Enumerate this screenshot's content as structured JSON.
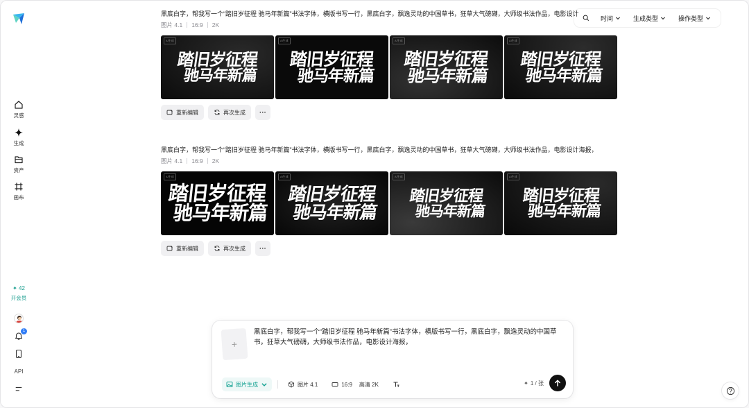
{
  "sidebar": {
    "nav": [
      {
        "label": "灵感",
        "icon": "home-icon"
      },
      {
        "label": "生成",
        "icon": "sparkle-icon"
      },
      {
        "label": "资产",
        "icon": "folder-icon"
      },
      {
        "label": "画布",
        "icon": "canvas-icon"
      }
    ],
    "credits": {
      "value": "✦ 42",
      "membership": "开会员"
    },
    "api_label": "API",
    "notification_count": "1"
  },
  "filterbar": {
    "time": "时间",
    "gen_type": "生成类型",
    "op_type": "操作类型"
  },
  "generations": [
    {
      "prompt": "黑底白字，帮我写一个“踏旧岁征程 驰马年新篇”书法字体，横版书写一行，黑底白字，飘逸灵动的中国草书，狂草大气磅礴，大师级书法作品，电影设计",
      "model": "图片 4.1",
      "ratio": "16:9",
      "resolution": "2K",
      "images": [
        {
          "line1": "踏旧岁征程",
          "line2": "驰马年新篇",
          "watermark": "AI生成"
        },
        {
          "line1": "踏旧岁征程",
          "line2": "驰马年新篇",
          "watermark": "AI生成"
        },
        {
          "line1": "踏旧岁征程",
          "line2": "驰马年新篇",
          "watermark": "AI生成"
        },
        {
          "line1": "踏旧岁征程",
          "line2": "驰马年新篇",
          "watermark": "AI生成"
        }
      ],
      "actions": {
        "edit": "重新编辑",
        "regenerate": "再次生成",
        "more": "···"
      }
    },
    {
      "prompt": "黑底白字，帮我写一个“踏旧岁征程 驰马年新篇”书法字体，横版书写一行，黑底白字，飘逸灵动的中国草书，狂草大气磅礴，大师级书法作品，电影设计海报，",
      "model": "图片 4.1",
      "ratio": "16:9",
      "resolution": "2K",
      "images": [
        {
          "line1": "踏旧岁征程",
          "line2": "驰马年新篇",
          "watermark": "AI生成"
        },
        {
          "line1": "踏旧岁征程",
          "line2": "驰马年新篇",
          "watermark": "AI生成"
        },
        {
          "line1": "踏旧岁征程",
          "line2": "驰马年新篇",
          "watermark": "AI生成"
        },
        {
          "line1": "踏旧岁征程",
          "line2": "驰马年新篇",
          "watermark": "AI生成"
        }
      ],
      "actions": {
        "edit": "重新编辑",
        "regenerate": "再次生成",
        "more": "···"
      }
    }
  ],
  "composer": {
    "text": "黑底白字，帮我写一个“踏旧岁征程 驰马年新篇”书法字体，横版书写一行，黑底白字，飘逸灵动的中国草书，狂草大气磅礴，大师级书法作品，电影设计海报，",
    "mode": "图片生成",
    "model": "图片 4.1",
    "ratio": "16:9",
    "quality": "高清 2K",
    "quota": "1 / 张"
  },
  "colors": {
    "accent": "#12a191",
    "send": "#111111",
    "badge": "#2f7cf6"
  }
}
